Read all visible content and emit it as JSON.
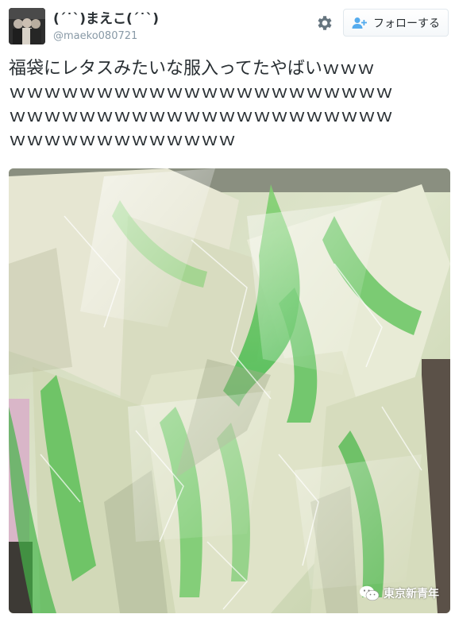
{
  "user": {
    "display_name": "(ˊ˙ˋ)まえこ(ˊ˙ˋ)",
    "handle": "@maeko080721",
    "avatar_icon": "avatar-photo"
  },
  "actions": {
    "settings_icon": "gear-icon",
    "follow_icon": "add-user-icon",
    "follow_label": "フォローする"
  },
  "tweet": {
    "lines": [
      "福袋にレタスみたいな服入ってたやばいｗｗｗ",
      "ｗｗｗｗｗｗｗｗｗｗｗｗｗｗｗｗｗｗｗｗｗｗ",
      "ｗｗｗｗｗｗｗｗｗｗｗｗｗｗｗｗｗｗｗｗｗｗ",
      "ｗｗｗｗｗｗｗｗｗｗｗｗｗ"
    ]
  },
  "photo": {
    "subject": "lettuce-like-green-and-white-garment-in-plastic-wrap",
    "colors": {
      "pale_green": "#d9e4c4",
      "leaf_green": "#5fc35a",
      "bright_green": "#3fb84a",
      "cream": "#ece8d8",
      "shadow": "#8f9a7e",
      "pink": "#e7a8c2"
    }
  },
  "watermark": {
    "logo_icon": "wechat-icon",
    "text": "東京新青年"
  },
  "colors": {
    "text": "#292f33",
    "muted": "#8899a6",
    "follow_blue": "#55acee",
    "border": "#e1e8ed"
  }
}
